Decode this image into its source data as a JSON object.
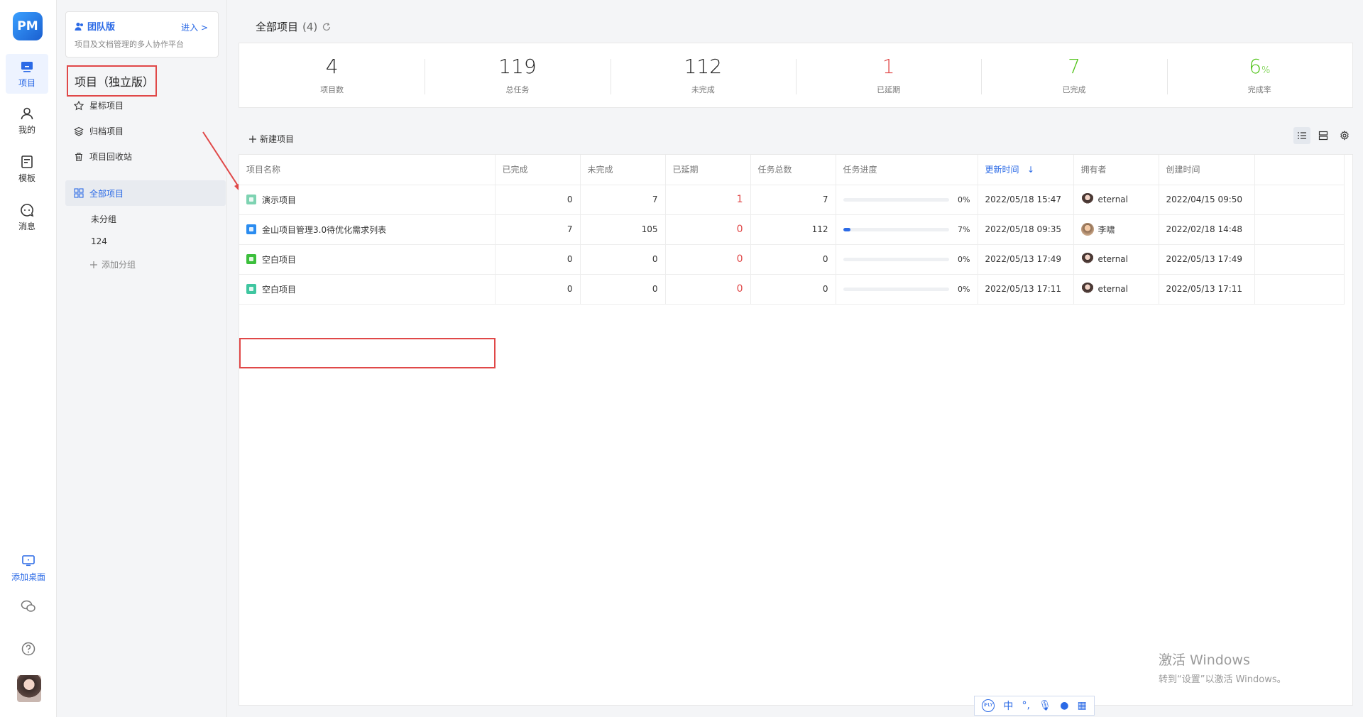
{
  "rail": {
    "logo": "PM",
    "items": [
      {
        "label": "项目"
      },
      {
        "label": "我的"
      },
      {
        "label": "模板"
      },
      {
        "label": "消息"
      }
    ],
    "add_desktop": "添加桌面"
  },
  "sidebar": {
    "team": {
      "title": "团队版",
      "enter": "进入 >",
      "subtitle": "项目及文档管理的多人协作平台"
    },
    "header": "项目（独立版）",
    "links": [
      {
        "label": "星标项目"
      },
      {
        "label": "归档项目"
      },
      {
        "label": "项目回收站"
      }
    ],
    "all_projects": "全部项目",
    "groups": [
      {
        "label": "未分组"
      },
      {
        "label": "124"
      }
    ],
    "add_group": "添加分组"
  },
  "main": {
    "title": "全部项目",
    "title_count": "(4)",
    "stats": [
      {
        "value": "4",
        "unit": "",
        "label": "项目数",
        "color": "#222222"
      },
      {
        "value": "119",
        "unit": "",
        "label": "总任务",
        "color": "#222222"
      },
      {
        "value": "112",
        "unit": "",
        "label": "未完成",
        "color": "#222222"
      },
      {
        "value": "1",
        "unit": "",
        "label": "已延期",
        "color": "#e04848"
      },
      {
        "value": "7",
        "unit": "",
        "label": "已完成",
        "color": "#52c41a"
      },
      {
        "value": "6",
        "unit": "%",
        "label": "完成率",
        "color": "#52c41a"
      }
    ],
    "new_project": "新建项目",
    "table": {
      "columns": [
        "项目名称",
        "已完成",
        "未完成",
        "已延期",
        "任务总数",
        "任务进度",
        "更新时间",
        "拥有者",
        "创建时间",
        ""
      ],
      "sort_arrow": "↓",
      "rows": [
        {
          "name": "演示项目",
          "icon_color": "#7ed3b2",
          "done": "0",
          "undone": "7",
          "delayed": "1",
          "total": "7",
          "progress": 0,
          "progress_text": "0%",
          "updated": "2022/05/18 15:47",
          "owner": "eternal",
          "owner_avatar": "eternal",
          "created": "2022/04/15 09:50"
        },
        {
          "name": "金山项目管理3.0待优化需求列表",
          "icon_color": "#2b8cf0",
          "done": "7",
          "undone": "105",
          "delayed": "0",
          "total": "112",
          "progress": 7,
          "progress_text": "7%",
          "updated": "2022/05/18 09:35",
          "owner": "李啸",
          "owner_avatar": "li",
          "created": "2022/02/18 14:48"
        },
        {
          "name": "空白项目",
          "icon_color": "#3cbf3c",
          "done": "0",
          "undone": "0",
          "delayed": "0",
          "total": "0",
          "progress": 0,
          "progress_text": "0%",
          "updated": "2022/05/13 17:49",
          "owner": "eternal",
          "owner_avatar": "eternal",
          "created": "2022/05/13 17:49"
        },
        {
          "name": "空白项目",
          "icon_color": "#3fc6a0",
          "done": "0",
          "undone": "0",
          "delayed": "0",
          "total": "0",
          "progress": 0,
          "progress_text": "0%",
          "updated": "2022/05/13 17:11",
          "owner": "eternal",
          "owner_avatar": "eternal",
          "created": "2022/05/13 17:11"
        }
      ]
    }
  },
  "watermark": {
    "line1": "激活 Windows",
    "line2": "转到“设置”以激活 Windows。"
  },
  "ime": {
    "brand": "iFLY",
    "lang": "中"
  }
}
